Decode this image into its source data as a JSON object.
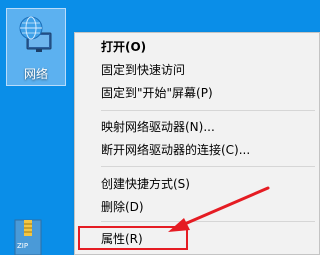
{
  "desktop": {
    "network_icon": {
      "label": "网络",
      "icon": "network-globe-icon",
      "selected": true
    },
    "zip_icon": {
      "label": "ZIP",
      "icon": "360zip-archive-icon"
    }
  },
  "context_menu": {
    "items": [
      {
        "label": "打开(O)",
        "bold": true
      },
      {
        "label": "固定到快速访问"
      },
      {
        "label": "固定到\"开始\"屏幕(P)"
      },
      {
        "label": "映射网络驱动器(N)..."
      },
      {
        "label": "断开网络驱动器的连接(C)..."
      },
      {
        "label": "创建快捷方式(S)"
      },
      {
        "label": "删除(D)"
      },
      {
        "label": "属性(R)"
      }
    ]
  },
  "annotation": {
    "color": "#e51c23",
    "target": "属性(R)"
  },
  "colors": {
    "desktop": "#0a8ee8",
    "menu_bg": "#f2f2f2",
    "annotation_red": "#e51c23"
  }
}
